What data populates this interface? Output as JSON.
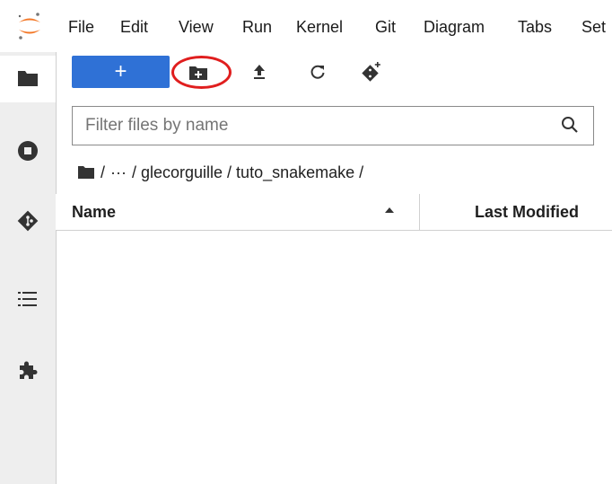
{
  "menubar": {
    "items": [
      "File",
      "Edit",
      "View",
      "Run",
      "Kernel",
      "Git",
      "Diagram",
      "Tabs",
      "Set"
    ]
  },
  "toolbar": {
    "new_launcher_label": "+",
    "icons": [
      "new-folder-icon",
      "upload-icon",
      "refresh-icon",
      "git-clone-icon"
    ]
  },
  "filter": {
    "placeholder": "Filter files by name",
    "value": ""
  },
  "breadcrumb": {
    "root": "/",
    "ellipsis": "···",
    "path": "/ glecorguille / tuto_snakemake /"
  },
  "table": {
    "columns": [
      "Name",
      "Last Modified"
    ],
    "rows": []
  },
  "colors": {
    "accent": "#2f71d6",
    "highlight": "#e01e1e",
    "logo": "#f37726"
  }
}
